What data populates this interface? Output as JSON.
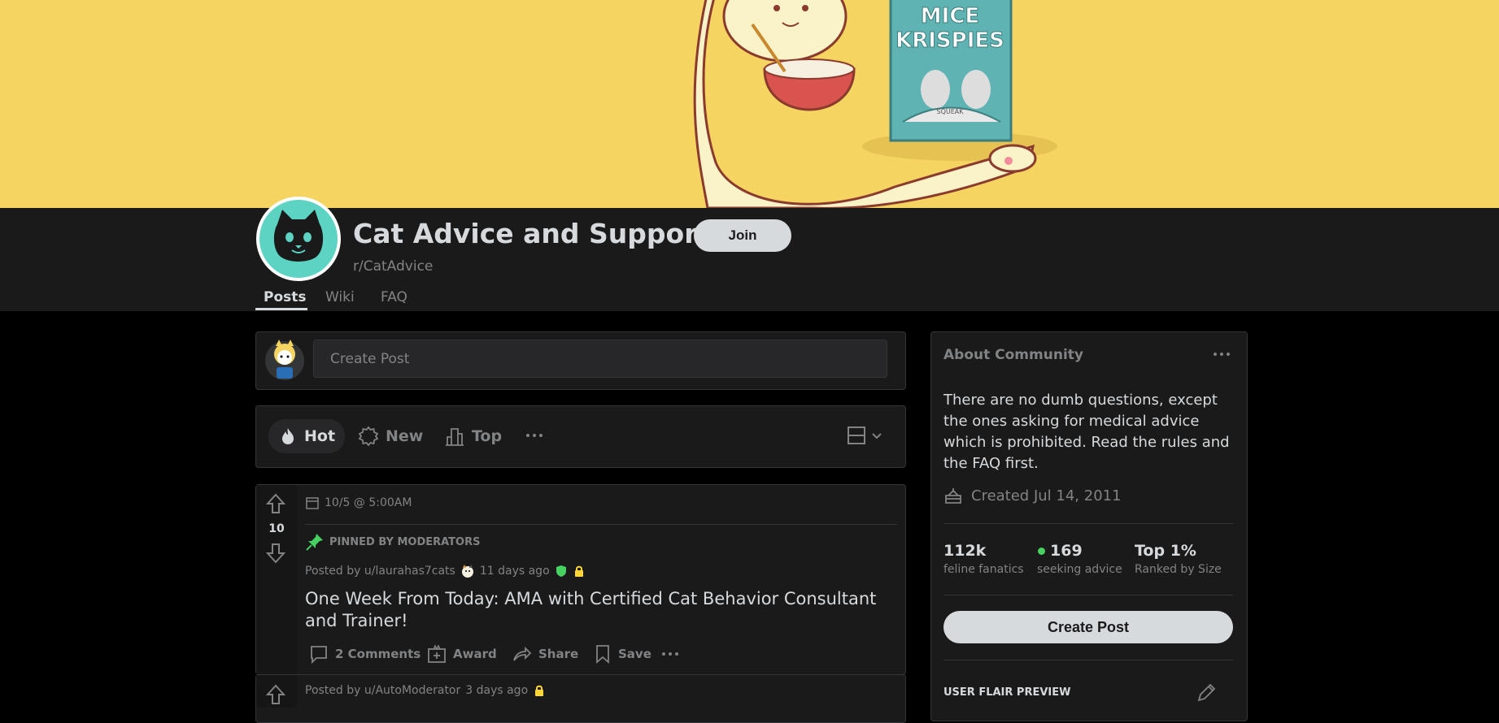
{
  "banner": {
    "box_text_line1": "MICE",
    "box_text_line2": "KRISPIES",
    "box_small_text": "SQUEAK",
    "colors": {
      "background": "#f5d462",
      "cat": "#fbf3c8",
      "box": "#5fb3b3",
      "bowl": "#d9534f"
    }
  },
  "community": {
    "title": "Cat Advice and Support",
    "name": "r/CatAdvice",
    "join_label": "Join",
    "icon": "cat-face-icon",
    "icon_color": "#5dd4c3"
  },
  "tabs": [
    {
      "label": "Posts",
      "active": true
    },
    {
      "label": "Wiki",
      "active": false
    },
    {
      "label": "FAQ",
      "active": false
    }
  ],
  "create_post": {
    "placeholder": "Create Post"
  },
  "sort_bar": {
    "options": [
      {
        "label": "Hot",
        "icon": "flame-icon",
        "active": true
      },
      {
        "label": "New",
        "icon": "new-badge-icon",
        "active": false
      },
      {
        "label": "Top",
        "icon": "top-chart-icon",
        "active": false
      }
    ],
    "more": "more-icon",
    "view": "card-view-icon"
  },
  "posts": [
    {
      "event": "10/5 @ 5:00AM",
      "votes": "10",
      "pinned_label": "PINNED BY MODERATORS",
      "posted_by": "Posted by u/laurahas7cats",
      "time": "11 days ago",
      "title": "One Week From Today: AMA with Certified Cat Behavior Consultant and Trainer!",
      "actions": {
        "comments": "2 Comments",
        "award": "Award",
        "share": "Share",
        "save": "Save"
      }
    },
    {
      "posted_by": "Posted by u/AutoModerator",
      "time": "3 days ago"
    }
  ],
  "about": {
    "heading": "About Community",
    "description": "There are no dumb questions, except the ones asking for medical advice which is prohibited. Read the rules and the FAQ first.",
    "created": "Created Jul 14, 2011",
    "stats": [
      {
        "value": "112k",
        "label": "feline fanatics"
      },
      {
        "value": "169",
        "label": "seeking advice",
        "online": true
      },
      {
        "value": "Top 1%",
        "label": "Ranked by Size"
      }
    ],
    "create_post_label": "Create Post",
    "flair_heading": "USER FLAIR PREVIEW"
  },
  "colors": {
    "page_bg": "#000000",
    "card_bg": "#1a1a1b",
    "border": "#343536",
    "text": "#d7dadc",
    "muted": "#818384",
    "online": "#46d160",
    "pin": "#46d160",
    "lock": "#ffd635",
    "mod_shield": "#46d160"
  }
}
